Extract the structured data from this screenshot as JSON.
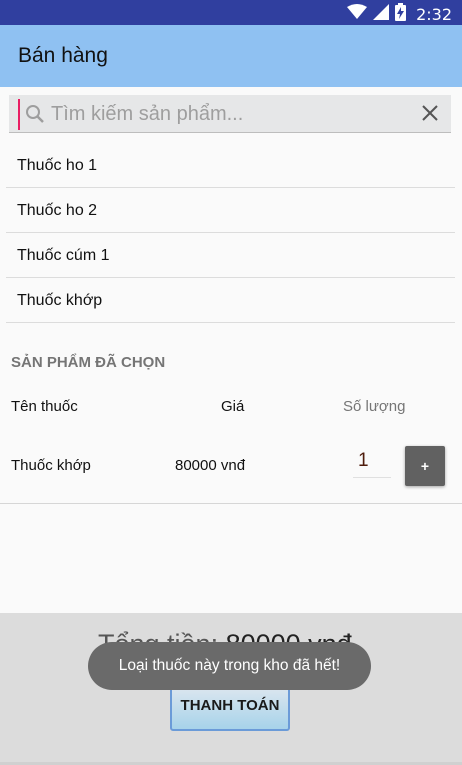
{
  "status_bar": {
    "time": "2:32"
  },
  "app_bar": {
    "title": "Bán hàng"
  },
  "search": {
    "placeholder": "Tìm kiếm sản phẩm..."
  },
  "products": [
    {
      "name": "Thuốc ho 1"
    },
    {
      "name": "Thuốc ho 2"
    },
    {
      "name": "Thuốc cúm 1"
    },
    {
      "name": "Thuốc khớp"
    }
  ],
  "selected": {
    "title": "SẢN PHẨM ĐÃ CHỌN",
    "headers": {
      "name": "Tên thuốc",
      "price": "Giá",
      "qty": "Số lượng"
    },
    "rows": [
      {
        "name": "Thuốc khớp",
        "price": "80000 vnđ",
        "qty": "1",
        "plus": "+"
      }
    ]
  },
  "total": {
    "label": "Tổng tiền: ",
    "value": "80000 vnđ"
  },
  "pay_button": {
    "label": "THANH TOÁN"
  },
  "toast": {
    "message": "Loại thuốc này trong kho đã hết!"
  },
  "colors": {
    "status_bar": "#303f9f",
    "app_bar": "#8fc1f2",
    "cursor": "#e91e63"
  },
  "icons": {
    "search": "search-icon",
    "clear": "close-icon",
    "wifi": "wifi-icon",
    "signal": "signal-icon",
    "battery": "battery-charging-icon"
  }
}
